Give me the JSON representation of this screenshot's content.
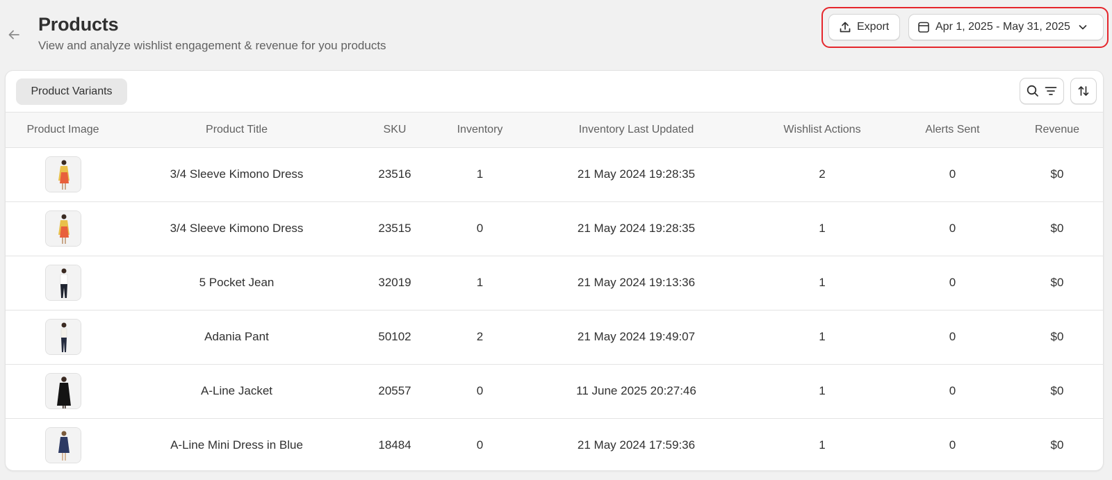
{
  "header": {
    "title": "Products",
    "subtitle": "View and analyze wishlist engagement & revenue for you products",
    "export_label": "Export",
    "date_range": "Apr 1, 2025 - May 31, 2025"
  },
  "toolbar": {
    "tab_label": "Product Variants"
  },
  "table": {
    "headers": [
      "Product Image",
      "Product Title",
      "SKU",
      "Inventory",
      "Inventory Last Updated",
      "Wishlist Actions",
      "Alerts Sent",
      "Revenue"
    ],
    "rows": [
      {
        "title": "3/4 Sleeve Kimono Dress",
        "sku": "23516",
        "inventory": "1",
        "updated": "21 May 2024 19:28:35",
        "wishlist": "2",
        "alerts": "0",
        "revenue": "$0",
        "image": "kimono-dress"
      },
      {
        "title": "3/4 Sleeve Kimono Dress",
        "sku": "23515",
        "inventory": "0",
        "updated": "21 May 2024 19:28:35",
        "wishlist": "1",
        "alerts": "0",
        "revenue": "$0",
        "image": "kimono-dress"
      },
      {
        "title": "5 Pocket Jean",
        "sku": "32019",
        "inventory": "1",
        "updated": "21 May 2024 19:13:36",
        "wishlist": "1",
        "alerts": "0",
        "revenue": "$0",
        "image": "jean"
      },
      {
        "title": "Adania Pant",
        "sku": "50102",
        "inventory": "2",
        "updated": "21 May 2024 19:49:07",
        "wishlist": "1",
        "alerts": "0",
        "revenue": "$0",
        "image": "pant"
      },
      {
        "title": "A-Line Jacket",
        "sku": "20557",
        "inventory": "0",
        "updated": "11 June 2025 20:27:46",
        "wishlist": "1",
        "alerts": "0",
        "revenue": "$0",
        "image": "jacket"
      },
      {
        "title": "A-Line Mini Dress in Blue",
        "sku": "18484",
        "inventory": "0",
        "updated": "21 May 2024 17:59:36",
        "wishlist": "1",
        "alerts": "0",
        "revenue": "$0",
        "image": "blue-dress"
      }
    ]
  },
  "colors": {
    "highlight": "#e5262c",
    "background": "#f1f1f1",
    "pill": "#e8e8e8"
  },
  "icons": [
    "arrow-left-icon",
    "upload-icon",
    "calendar-icon",
    "chevron-down-icon",
    "search-icon",
    "filter-icon",
    "sort-icon"
  ]
}
